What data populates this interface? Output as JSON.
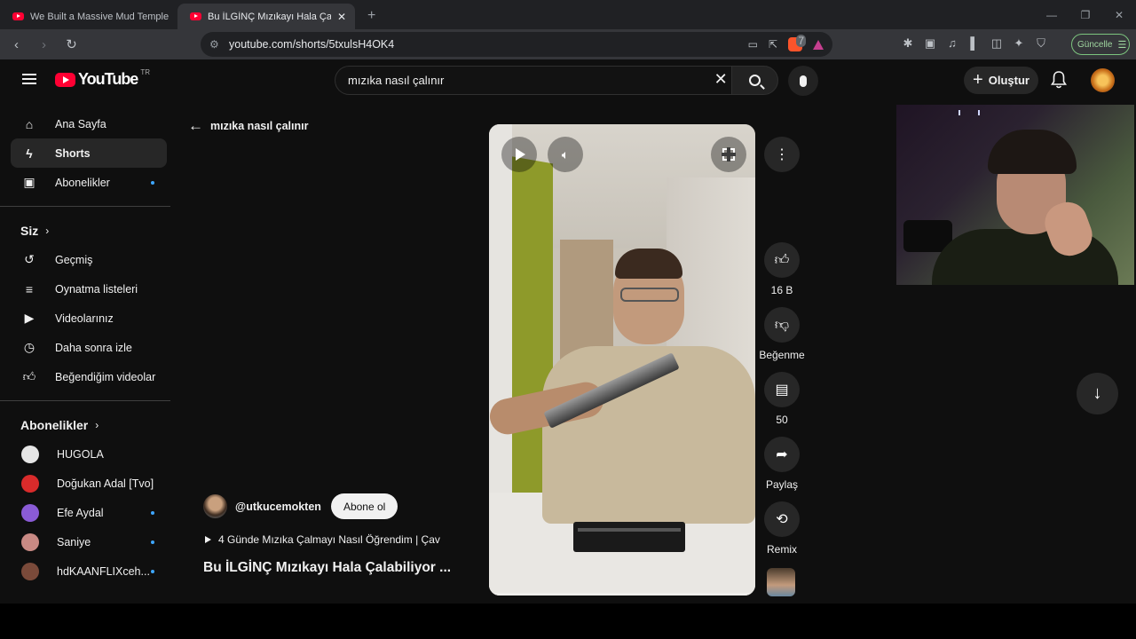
{
  "browser": {
    "tabs": [
      {
        "title": "We Built a Massive Mud Temple Hou",
        "active": false
      },
      {
        "title": "Bu İLGİNÇ Mızıkayı Hala Çalabili",
        "active": true
      }
    ],
    "url": "youtube.com/shorts/5txulsH4OK4",
    "brave_badge": "7",
    "update_label": "Güncelle"
  },
  "masthead": {
    "logo_text": "YouTube",
    "country_code": "TR",
    "search_value": "mızıka nasıl çalınır",
    "create_label": "Oluştur"
  },
  "sidebar": {
    "main": [
      {
        "label": "Ana Sayfa",
        "icon": "home-icon"
      },
      {
        "label": "Shorts",
        "icon": "shorts-icon",
        "active": true
      },
      {
        "label": "Abonelikler",
        "icon": "subscriptions-icon",
        "dot": true
      }
    ],
    "you_header": "Siz",
    "you": [
      {
        "label": "Geçmiş",
        "icon": "history-icon"
      },
      {
        "label": "Oynatma listeleri",
        "icon": "playlists-icon"
      },
      {
        "label": "Videolarınız",
        "icon": "your-videos-icon"
      },
      {
        "label": "Daha sonra izle",
        "icon": "watch-later-icon"
      },
      {
        "label": "Beğendiğim videolar",
        "icon": "liked-videos-icon"
      }
    ],
    "subs_header": "Abonelikler",
    "subscriptions": [
      {
        "label": "HUGOLA",
        "color": "#e6e6e6",
        "dot": false
      },
      {
        "label": "Doğukan Adal [Tvo]",
        "color": "#d92b2b",
        "dot": false
      },
      {
        "label": "Efe Aydal",
        "color": "#8a5bd6",
        "dot": true
      },
      {
        "label": "Saniye",
        "color": "#c98a84",
        "dot": true
      },
      {
        "label": "hdKAANFLIXceh...",
        "color": "#7a4a3a",
        "dot": true
      }
    ]
  },
  "short": {
    "back_query": "mızıka nasıl çalınır",
    "channel": "@utkucemokten",
    "subscribe_label": "Abone ol",
    "sound": "4 Günde Mızıka Çalmayı Nasıl Öğrendim | Çav",
    "title": "Bu İLGİNÇ Mızıkayı Hala Çalabiliyor ...",
    "progress": 0.0,
    "actions": {
      "likes": "16 B",
      "dislike_label": "Beğenme",
      "comments": "50",
      "share_label": "Paylaş",
      "remix_label": "Remix"
    }
  },
  "colors": {
    "brand_red": "#ff0033",
    "background": "#0f0f0f",
    "chip": "#272727",
    "accent_blue": "#3ea6ff"
  }
}
